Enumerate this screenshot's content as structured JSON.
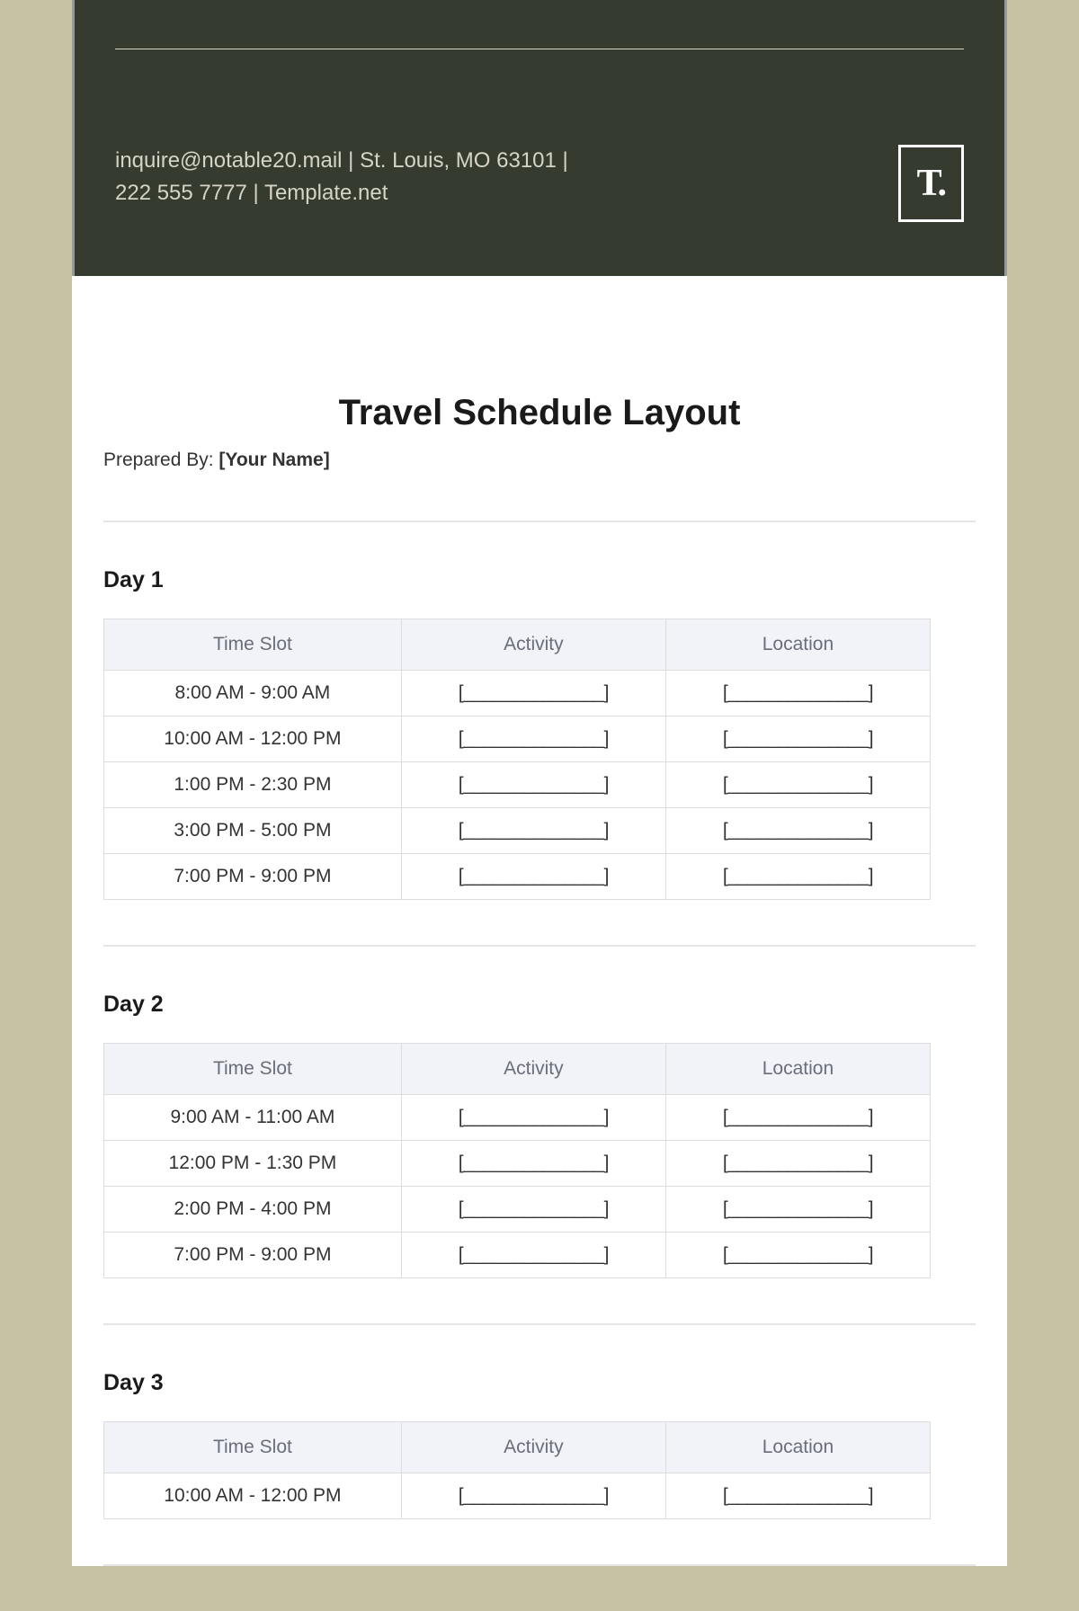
{
  "header": {
    "contact_line1": "inquire@notable20.mail | St. Louis, MO 63101 |",
    "contact_line2": "222 555 7777 | Template.net",
    "logo": "T."
  },
  "document": {
    "title": "Travel Schedule Layout",
    "prepared_label": "Prepared By: ",
    "prepared_value": "[Your Name]"
  },
  "columns": {
    "time_slot": "Time Slot",
    "activity": "Activity",
    "location": "Location"
  },
  "blank": "[______________]",
  "days": [
    {
      "title": "Day 1",
      "rows": [
        {
          "time": "8:00 AM - 9:00 AM"
        },
        {
          "time": "10:00 AM - 12:00 PM"
        },
        {
          "time": "1:00 PM - 2:30 PM"
        },
        {
          "time": "3:00 PM - 5:00 PM"
        },
        {
          "time": "7:00 PM - 9:00 PM"
        }
      ]
    },
    {
      "title": "Day 2",
      "rows": [
        {
          "time": "9:00 AM - 11:00 AM"
        },
        {
          "time": "12:00 PM - 1:30 PM"
        },
        {
          "time": "2:00 PM - 4:00 PM"
        },
        {
          "time": "7:00 PM - 9:00 PM"
        }
      ]
    },
    {
      "title": "Day 3",
      "rows": [
        {
          "time": "10:00 AM - 12:00 PM"
        }
      ]
    }
  ]
}
